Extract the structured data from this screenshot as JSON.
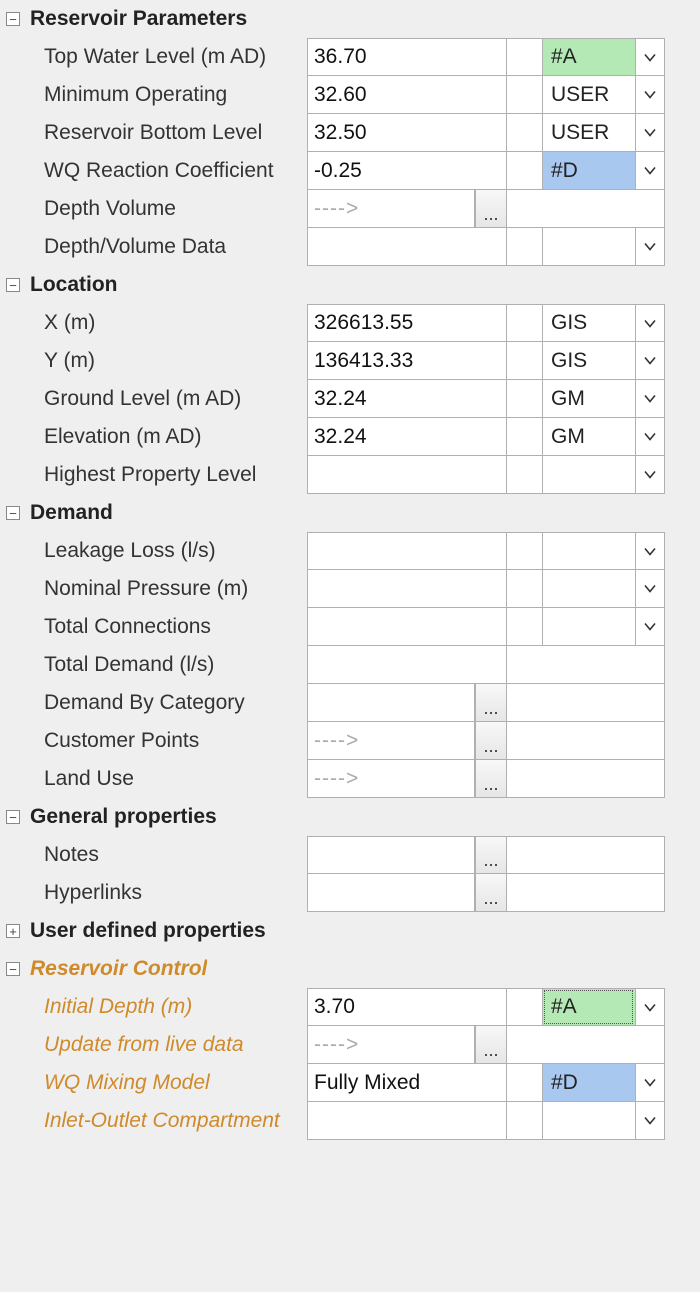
{
  "icons": {
    "arrow_placeholder": "---->",
    "ellipsis": "..."
  },
  "tags": {
    "A": "#A",
    "D": "#D",
    "USER": "USER",
    "GIS": "GIS",
    "GM": "GM"
  },
  "sections": {
    "reservoir_params": {
      "title": "Reservoir Parameters",
      "expanded": true,
      "rows": {
        "top_water": {
          "label": "Top Water Level (m AD)",
          "value": "36.70",
          "tag": "#A",
          "tagColor": "green"
        },
        "min_op": {
          "label": "Minimum Operating",
          "value": "32.60",
          "tag": "USER",
          "tagColor": ""
        },
        "bottom": {
          "label": "Reservoir Bottom Level",
          "value": "32.50",
          "tag": "USER",
          "tagColor": ""
        },
        "wq_coeff": {
          "label": "WQ Reaction Coefficient",
          "value": "-0.25",
          "tag": "#D",
          "tagColor": "blue"
        },
        "depth_vol": {
          "label": "Depth Volume",
          "value": "",
          "placeholder": true,
          "ellipsis": true
        },
        "depth_vol_data": {
          "label": "Depth/Volume Data",
          "value": "",
          "tag": "",
          "drop": true
        }
      }
    },
    "location": {
      "title": "Location",
      "expanded": true,
      "rows": {
        "x": {
          "label": "X (m)",
          "value": "326613.55",
          "tag": "GIS"
        },
        "y": {
          "label": "Y (m)",
          "value": "136413.33",
          "tag": "GIS"
        },
        "ground": {
          "label": "Ground Level (m AD)",
          "value": "32.24",
          "tag": "GM"
        },
        "elev": {
          "label": "Elevation (m AD)",
          "value": "32.24",
          "tag": "GM"
        },
        "hpl": {
          "label": "Highest Property Level",
          "value": "",
          "tag": "",
          "drop": true
        }
      }
    },
    "demand": {
      "title": "Demand",
      "expanded": true,
      "rows": {
        "leak": {
          "label": "Leakage Loss (l/s)",
          "value": "",
          "tag": "",
          "drop": true
        },
        "nomp": {
          "label": "Nominal Pressure (m)",
          "value": "",
          "tag": "",
          "drop": true
        },
        "tconn": {
          "label": "Total Connections",
          "value": "",
          "tag": "",
          "drop": true
        },
        "tdem": {
          "label": "Total Demand (l/s)",
          "value": "",
          "notag": true
        },
        "dcat": {
          "label": "Demand By Category",
          "value": "",
          "ellipsis": true,
          "notag": true
        },
        "cust": {
          "label": "Customer Points",
          "value": "",
          "placeholder": true,
          "ellipsis": true,
          "notag": true
        },
        "land": {
          "label": "Land Use",
          "value": "",
          "placeholder": true,
          "ellipsis": true,
          "notag": true
        }
      }
    },
    "general": {
      "title": "General properties",
      "expanded": true,
      "rows": {
        "notes": {
          "label": "Notes",
          "value": "",
          "ellipsis": true,
          "notag": true
        },
        "hyper": {
          "label": "Hyperlinks",
          "value": "",
          "ellipsis": true,
          "notag": true
        }
      }
    },
    "user_def": {
      "title": "User defined properties",
      "expanded": false
    },
    "res_ctrl": {
      "title": "Reservoir Control",
      "expanded": true,
      "orange": true,
      "rows": {
        "idepth": {
          "label": "Initial Depth (m)",
          "value": "3.70",
          "tag": "#A",
          "tagColor": "green",
          "dashed": true
        },
        "upd": {
          "label": "Update from live data",
          "value": "",
          "placeholder": true,
          "ellipsis": true,
          "notag_white": true
        },
        "wqmix": {
          "label": "WQ Mixing Model",
          "value": "Fully Mixed",
          "tag": "#D",
          "tagColor": "blue"
        },
        "inout": {
          "label": "Inlet-Outlet Compartment",
          "value": "",
          "tag": "",
          "drop": true
        }
      }
    }
  }
}
